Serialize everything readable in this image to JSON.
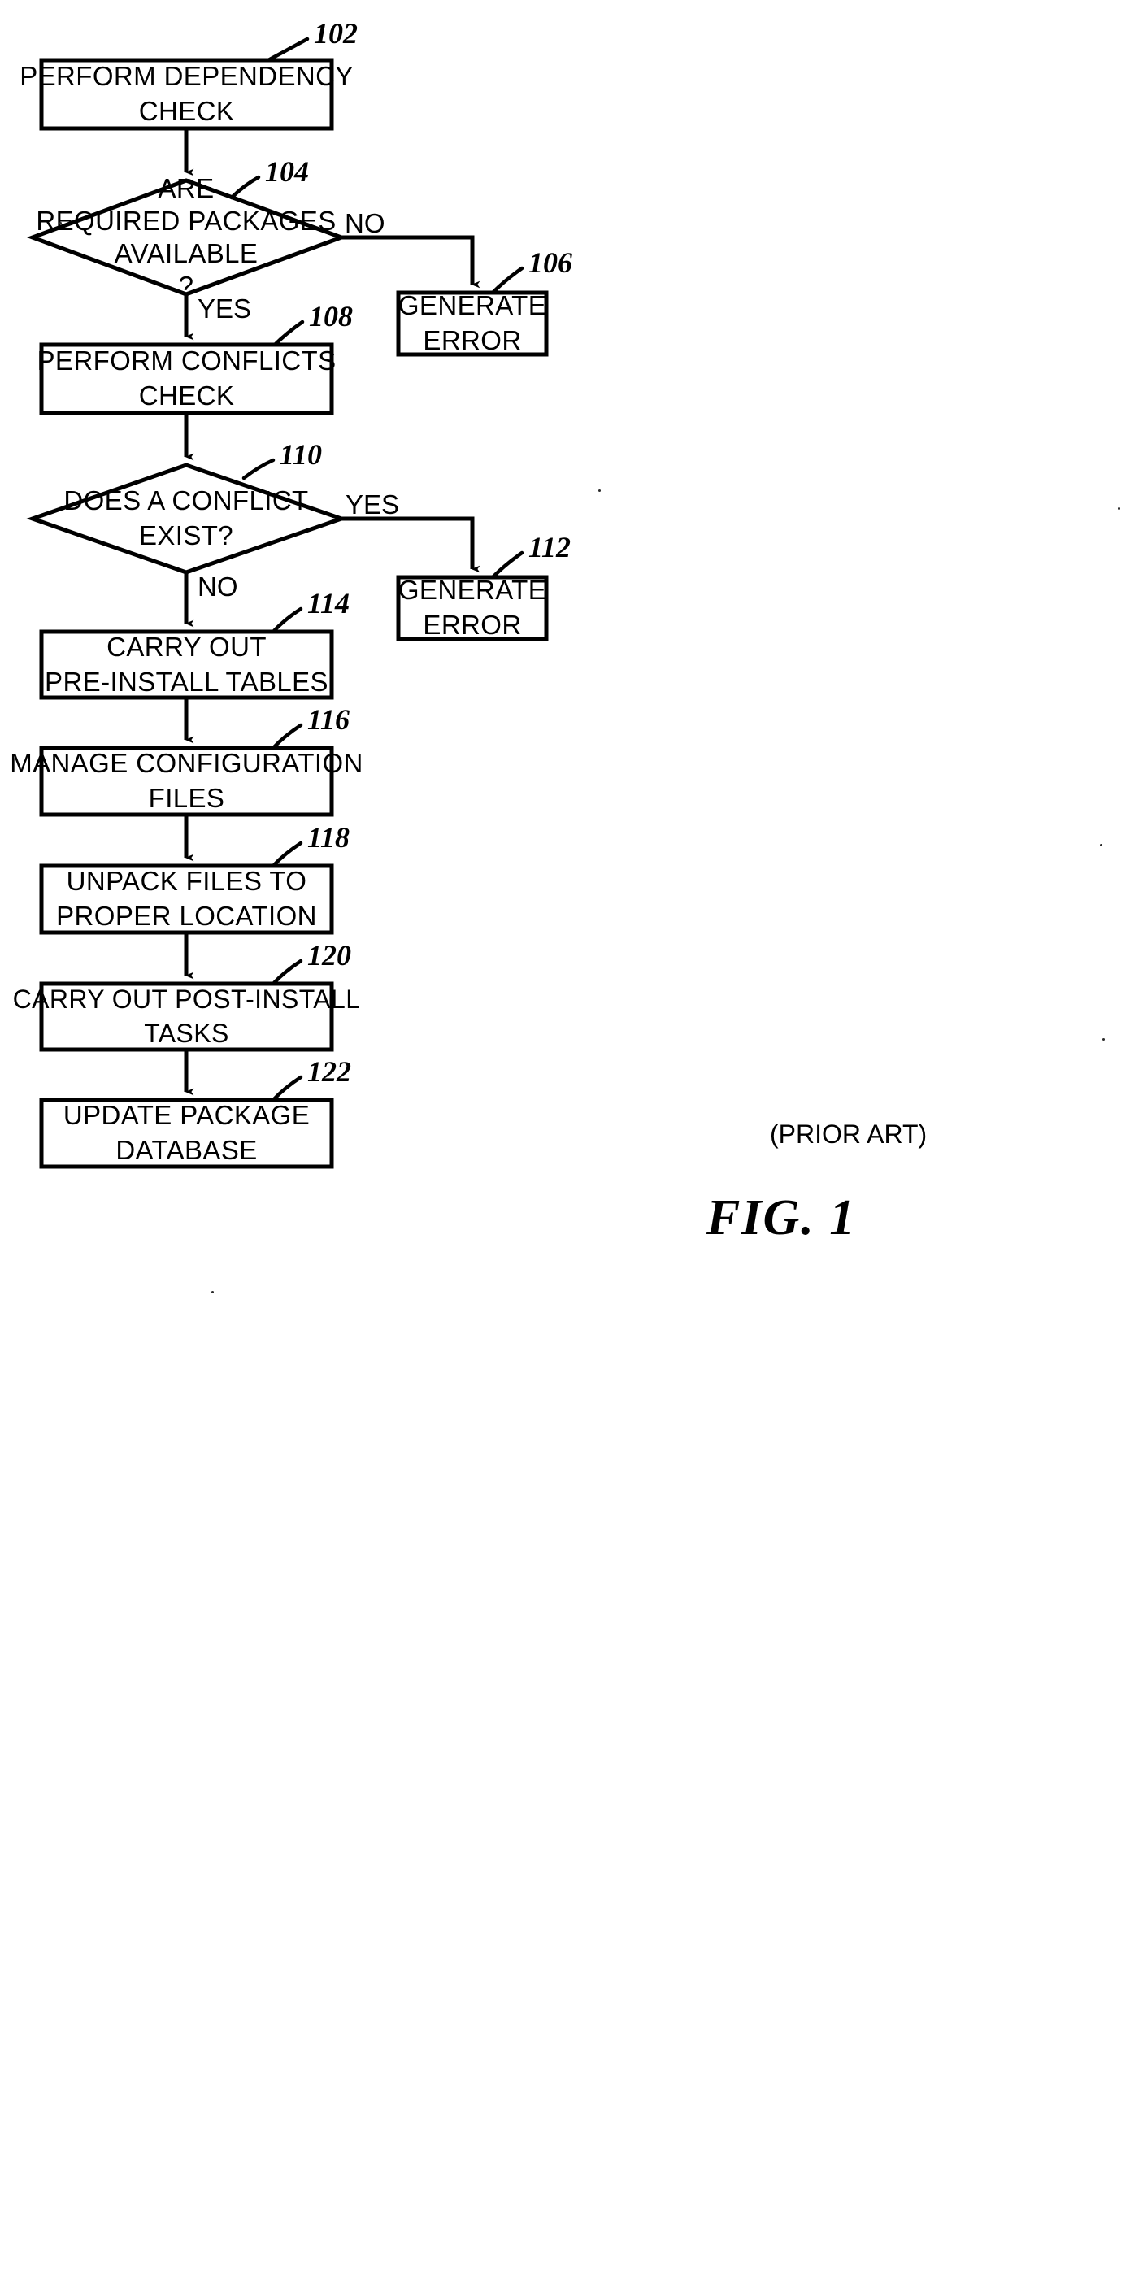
{
  "figure": {
    "caption": "FIG. 1",
    "prior_art_note": "(PRIOR ART)"
  },
  "nodes": [
    {
      "id": "perform-dependency-check",
      "ref": "102",
      "shape": "process",
      "lines": [
        "PERFORM DEPENDENCY",
        "CHECK"
      ]
    },
    {
      "id": "are-required-packages-available",
      "ref": "104",
      "shape": "decision",
      "lines": [
        "ARE",
        "REQUIRED PACKAGES",
        "AVAILABLE",
        "?"
      ]
    },
    {
      "id": "generate-error-dependency",
      "ref": "106",
      "shape": "process",
      "lines": [
        "GENERATE",
        "ERROR"
      ]
    },
    {
      "id": "perform-conflicts-check",
      "ref": "108",
      "shape": "process",
      "lines": [
        "PERFORM CONFLICTS",
        "CHECK"
      ]
    },
    {
      "id": "does-a-conflict-exist",
      "ref": "110",
      "shape": "decision",
      "lines": [
        "DOES A CONFLICT",
        "EXIST?"
      ]
    },
    {
      "id": "generate-error-conflict",
      "ref": "112",
      "shape": "process",
      "lines": [
        "GENERATE",
        "ERROR"
      ]
    },
    {
      "id": "carry-out-pre-install-tables",
      "ref": "114",
      "shape": "process",
      "lines": [
        "CARRY OUT",
        "PRE-INSTALL TABLES"
      ]
    },
    {
      "id": "manage-configuration-files",
      "ref": "116",
      "shape": "process",
      "lines": [
        "MANAGE CONFIGURATION",
        "FILES"
      ]
    },
    {
      "id": "unpack-files-to-proper-location",
      "ref": "118",
      "shape": "process",
      "lines": [
        "UNPACK FILES TO",
        "PROPER LOCATION"
      ]
    },
    {
      "id": "carry-out-post-install-tasks",
      "ref": "120",
      "shape": "process",
      "lines": [
        "CARRY OUT POST-INSTALL",
        "TASKS"
      ]
    },
    {
      "id": "update-package-database",
      "ref": "122",
      "shape": "process",
      "lines": [
        "UPDATE PACKAGE",
        "DATABASE"
      ]
    }
  ],
  "edge_labels": {
    "dependency_no": "NO",
    "dependency_yes": "YES",
    "conflict_yes": "YES",
    "conflict_no": "NO"
  },
  "colors": {
    "stroke": "#000000",
    "background": "#ffffff",
    "text": "#000000"
  }
}
